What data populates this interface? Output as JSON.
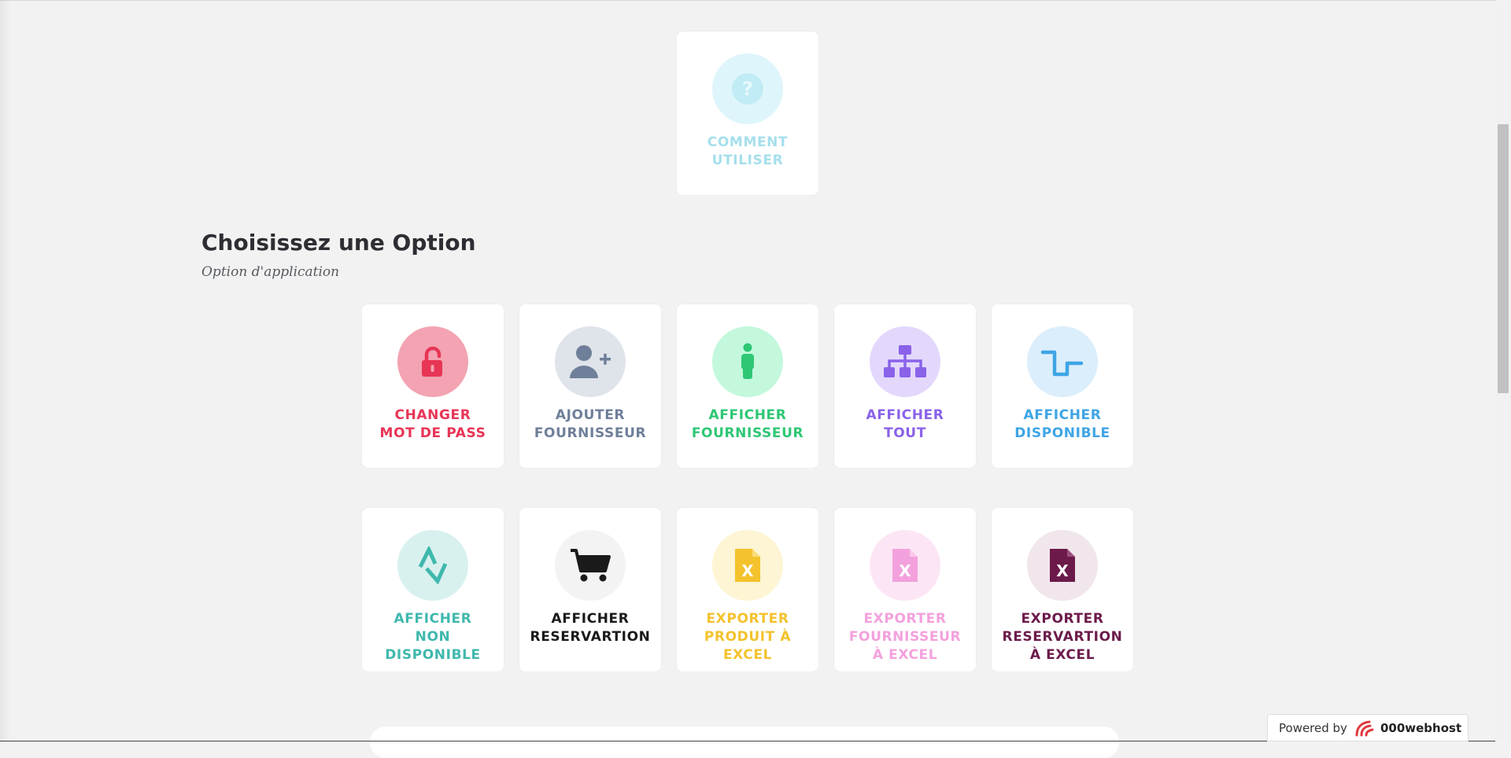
{
  "top_card": {
    "label_line1": "COMMENT",
    "label_line2": "UTILISER",
    "icon": "question-circle-icon",
    "color": "#a5dfec",
    "bg": "#def6fb"
  },
  "section": {
    "title": "Choisissez une Option",
    "subtitle": "Option d'application"
  },
  "row1": [
    {
      "line1": "CHANGER",
      "line2": "MOT DE PASS",
      "icon": "unlock-icon",
      "color": "#e83556",
      "bg": "#f3a3b2"
    },
    {
      "line1": "AJOUTER",
      "line2": "FOURNISSEUR",
      "icon": "user-plus-icon",
      "color": "#6f7f99",
      "bg": "#dfe3ea"
    },
    {
      "line1": "AFFICHER",
      "line2": "FOURNISSEUR",
      "icon": "person-icon",
      "color": "#2ec774",
      "bg": "#c3f8dc"
    },
    {
      "line1": "AFFICHER",
      "line2": "TOUT",
      "icon": "sitemap-icon",
      "color": "#8a62ea",
      "bg": "#e3d8fc"
    },
    {
      "line1": "AFFICHER",
      "line2": "DISPONIBLE",
      "icon": "square-wave-icon",
      "color": "#3ea5e5",
      "bg": "#dbeefb"
    }
  ],
  "row2": [
    {
      "line1": "AFFICHER",
      "line2": "NON",
      "line3": "DISPONIBLE",
      "icon": "activity-icon",
      "color": "#3fb8ad",
      "bg": "#d8f1ef"
    },
    {
      "line1": "AFFICHER",
      "line2": "RESERVARTION",
      "icon": "cart-icon",
      "color": "#1a1a1a",
      "bg": "#f3f3f3"
    },
    {
      "line1": "EXPORTER",
      "line2": "PRODUIT À",
      "line3": "EXCEL",
      "icon": "excel-file-icon",
      "color": "#f4c22c",
      "bg": "#fdf5d3"
    },
    {
      "line1": "EXPORTER",
      "line2": "FOURNISSEUR",
      "line3": "À EXCEL",
      "icon": "excel-file-icon",
      "color": "#f3a1dd",
      "bg": "#fce6f5"
    },
    {
      "line1": "EXPORTER",
      "line2": "RESERVARTION",
      "line3": "À EXCEL",
      "icon": "excel-file-icon",
      "color": "#6c1a4a",
      "bg": "#f0e6ec"
    }
  ],
  "footer_badge": {
    "prefix": "Powered by",
    "brand": "000webhost"
  }
}
